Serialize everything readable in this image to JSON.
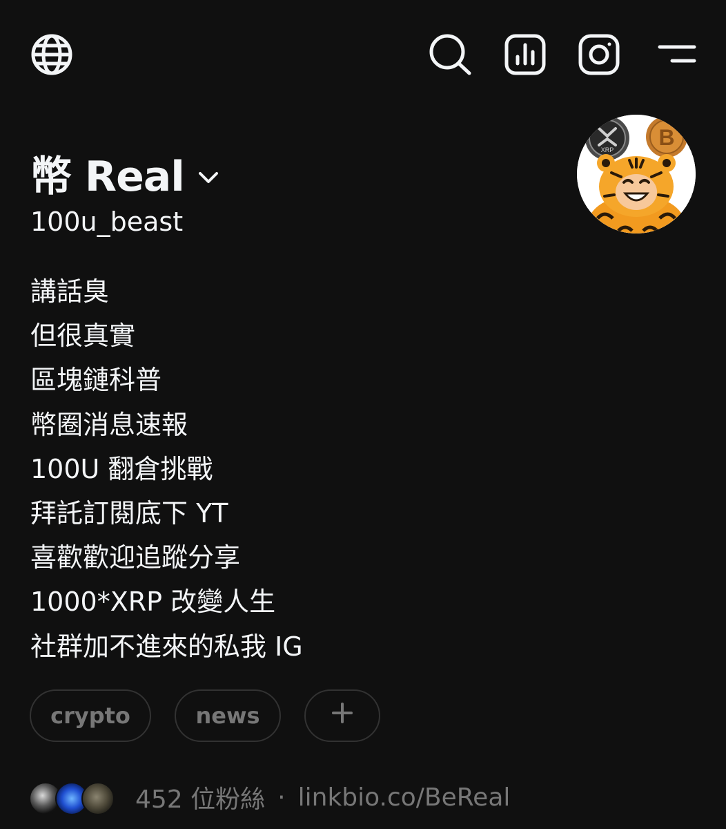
{
  "header": {
    "icons": [
      "globe-icon",
      "search-icon",
      "insights-icon",
      "instagram-icon",
      "menu-icon"
    ]
  },
  "profile": {
    "display_name": "幣 Real",
    "username": "100u_beast",
    "bio_lines": [
      "講話臭",
      "但很真實",
      "區塊鏈科普",
      "幣圈消息速報",
      "100U 翻倉挑戰",
      "拜託訂閱底下 YT",
      "喜歡歡迎追蹤分享",
      "1000*XRP 改變人生",
      "社群加不進來的私我 IG"
    ],
    "avatar_coins": [
      "XRP",
      "B"
    ]
  },
  "tags": [
    "crypto",
    "news",
    "+"
  ],
  "footer": {
    "followers": "452 位粉絲",
    "separator": "·",
    "link": "linkbio.co/BeReal"
  },
  "colors": {
    "background": "#101010",
    "text": "#f3f5f7",
    "muted": "#777777",
    "border": "#323232"
  }
}
